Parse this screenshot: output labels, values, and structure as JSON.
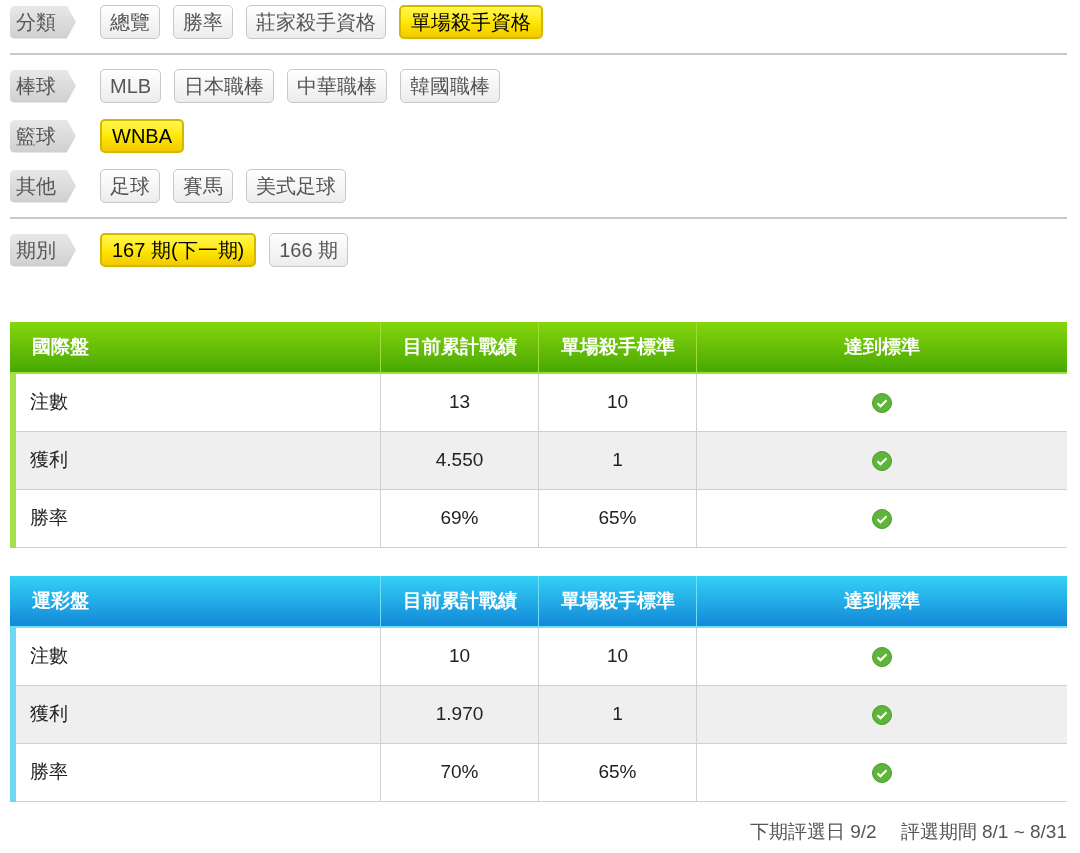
{
  "filter_sections": [
    {
      "groups": [
        {
          "label": "分類",
          "options": [
            {
              "label": "總覽",
              "selected": false
            },
            {
              "label": "勝率",
              "selected": false
            },
            {
              "label": "莊家殺手資格",
              "selected": false
            },
            {
              "label": "單場殺手資格",
              "selected": true
            }
          ]
        }
      ]
    },
    {
      "groups": [
        {
          "label": "棒球",
          "options": [
            {
              "label": "MLB",
              "selected": false
            },
            {
              "label": "日本職棒",
              "selected": false
            },
            {
              "label": "中華職棒",
              "selected": false
            },
            {
              "label": "韓國職棒",
              "selected": false
            }
          ]
        },
        {
          "label": "籃球",
          "options": [
            {
              "label": "WNBA",
              "selected": true
            }
          ]
        },
        {
          "label": "其他",
          "options": [
            {
              "label": "足球",
              "selected": false
            },
            {
              "label": "賽馬",
              "selected": false
            },
            {
              "label": "美式足球",
              "selected": false
            }
          ]
        }
      ]
    },
    {
      "groups": [
        {
          "label": "期別",
          "options": [
            {
              "label": "167 期(下一期)",
              "selected": true
            },
            {
              "label": "166 期",
              "selected": false
            }
          ]
        }
      ]
    }
  ],
  "tables": [
    {
      "kind": "green",
      "columns": [
        "國際盤",
        "目前累計戰績",
        "單場殺手標準",
        "達到標準"
      ],
      "rows": [
        {
          "label": "注數",
          "current": "13",
          "standard": "10",
          "met": true
        },
        {
          "label": "獲利",
          "current": "4.550",
          "standard": "1",
          "met": true
        },
        {
          "label": "勝率",
          "current": "69%",
          "standard": "65%",
          "met": true
        }
      ]
    },
    {
      "kind": "blue",
      "columns": [
        "運彩盤",
        "目前累計戰績",
        "單場殺手標準",
        "達到標準"
      ],
      "rows": [
        {
          "label": "注數",
          "current": "10",
          "standard": "10",
          "met": true
        },
        {
          "label": "獲利",
          "current": "1.970",
          "standard": "1",
          "met": true
        },
        {
          "label": "勝率",
          "current": "70%",
          "standard": "65%",
          "met": true
        }
      ]
    }
  ],
  "footer": {
    "next_selection": "下期評選日 9/2",
    "period": "評選期間 8/1 ~ 8/31"
  }
}
